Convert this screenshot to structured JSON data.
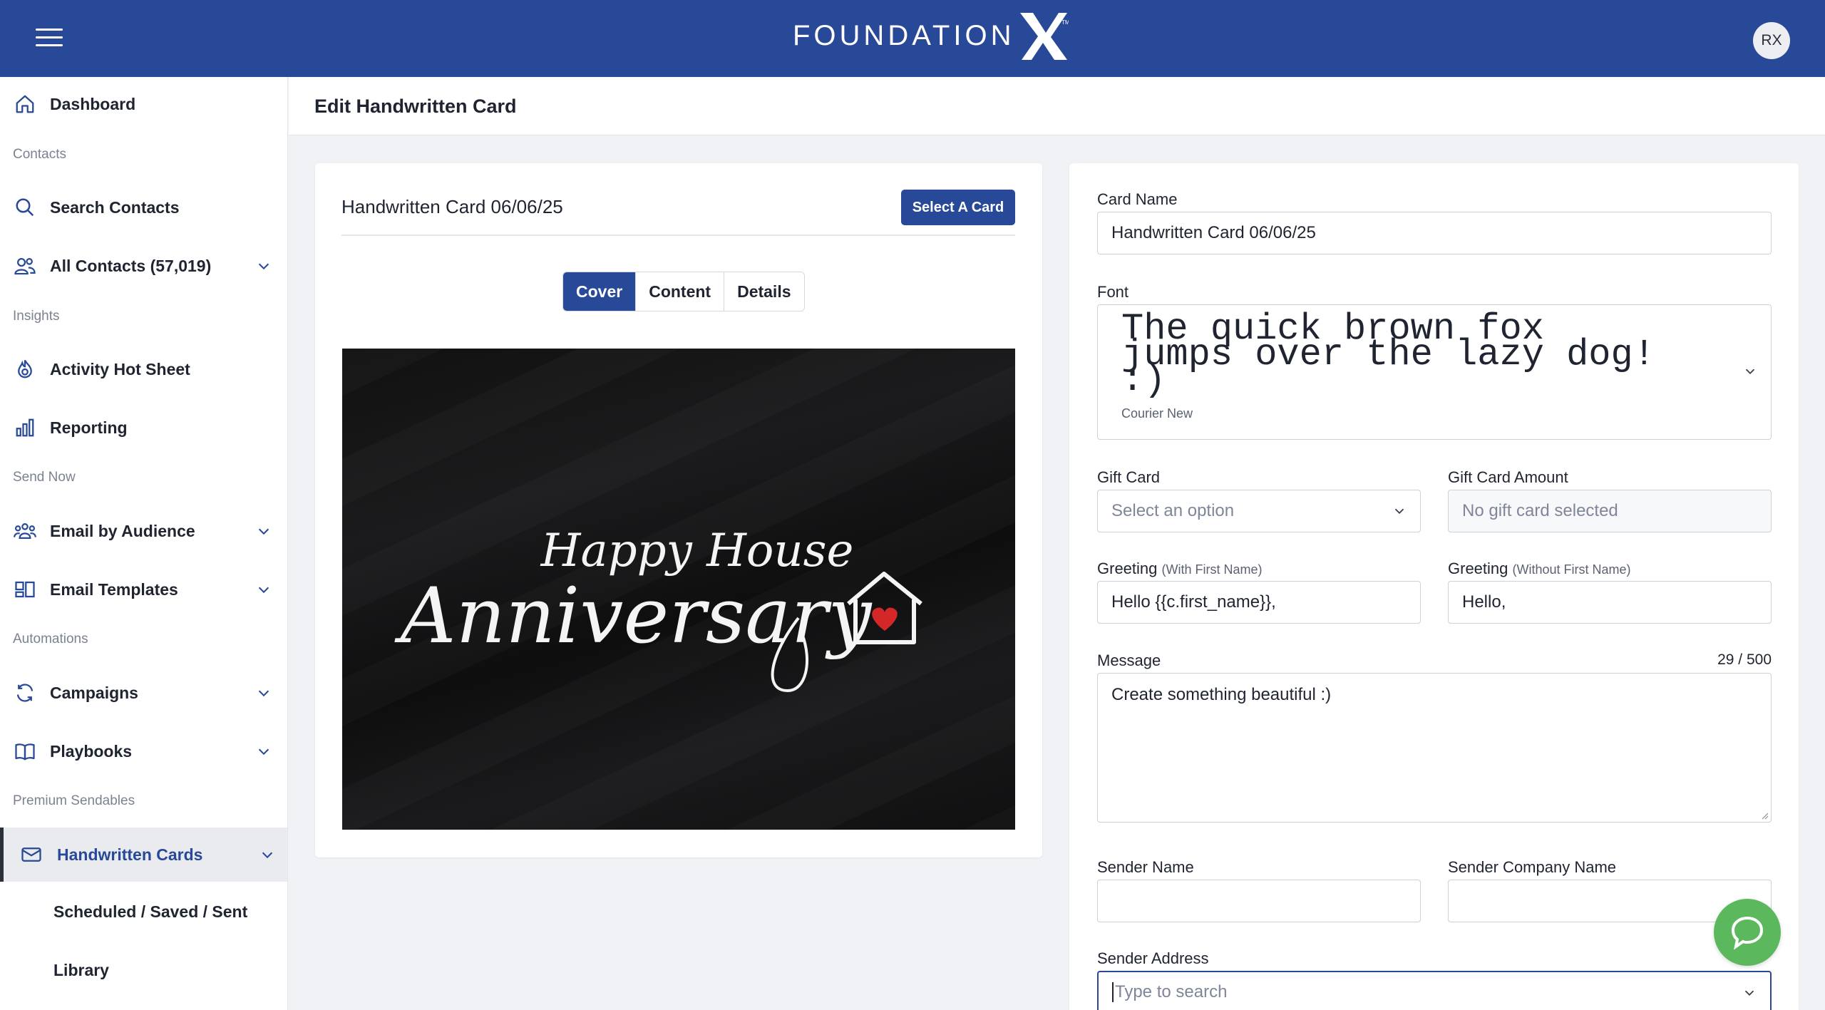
{
  "header": {
    "logo_text": "FOUNDATION",
    "logo_mark": "X",
    "user_initials": "RX"
  },
  "sidebar": {
    "dashboard": "Dashboard",
    "section_contacts": "Contacts",
    "search_contacts": "Search Contacts",
    "all_contacts": "All Contacts (57,019)",
    "section_insights": "Insights",
    "activity_hot_sheet": "Activity Hot Sheet",
    "reporting": "Reporting",
    "section_send_now": "Send Now",
    "email_by_audience": "Email by Audience",
    "email_templates": "Email Templates",
    "section_automations": "Automations",
    "campaigns": "Campaigns",
    "playbooks": "Playbooks",
    "section_premium": "Premium Sendables",
    "handwritten_cards": "Handwritten Cards",
    "scheduled": "Scheduled / Saved / Sent",
    "library": "Library"
  },
  "page": {
    "title": "Edit Handwritten Card"
  },
  "card": {
    "name": "Handwritten Card 06/06/25",
    "select_button": "Select A Card",
    "tabs": [
      "Cover",
      "Content",
      "Details"
    ],
    "active_tab": "Cover",
    "art_line1": "Happy House",
    "art_line2": "Anniversary"
  },
  "form": {
    "card_name_label": "Card Name",
    "card_name_value": "Handwritten Card 06/06/25",
    "font_label": "Font",
    "font_sample": "The quick brown fox jumps over the lazy dog! :)",
    "font_name": "Courier New",
    "gift_card_label": "Gift Card",
    "gift_card_placeholder": "Select an option",
    "gift_amount_label": "Gift Card Amount",
    "gift_amount_value": "No gift card selected",
    "greeting_label": "Greeting",
    "greeting_with_hint": "(With First Name)",
    "greeting_with_value": "Hello {{c.first_name}},",
    "greeting_without_hint": "(Without First Name)",
    "greeting_without_value": "Hello,",
    "message_label": "Message",
    "message_count": "29 / 500",
    "message_value": "Create something beautiful :)",
    "sender_name_label": "Sender Name",
    "sender_company_label": "Sender Company Name",
    "sender_address_label": "Sender Address",
    "sender_address_placeholder": "Type to search"
  },
  "colors": {
    "brand": "#284998",
    "help": "#5cb85c"
  }
}
